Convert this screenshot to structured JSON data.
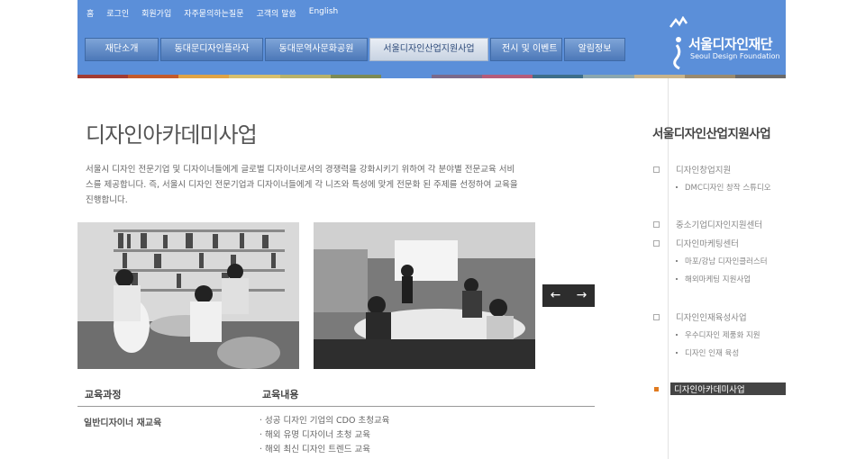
{
  "utility_nav": [
    "홈",
    "로그인",
    "회원가입",
    "자주묻의하는질문",
    "고객의 말씀",
    "English"
  ],
  "gnb": {
    "tabs": [
      "재단소개",
      "동대문디자인플라자",
      "동대문역사문화공원",
      "서울디자인산업지원사업",
      "전시 및 이벤트",
      "알림정보"
    ]
  },
  "logo": {
    "name": "서울디자인재단",
    "english": "Seoul Design Foundation"
  },
  "colorbar": [
    "#a23b32",
    "#c45a2a",
    "#e0a445",
    "#d7bf6c",
    "#b8b26a",
    "#7c8a55",
    "#5b8fd9",
    "#7a6a8c",
    "#b45c7a",
    "#3d6e8a",
    "#8aa7b0",
    "#c9b48a",
    "#9a8a6e",
    "#6a6a6a"
  ],
  "main": {
    "title": "디자인아카데미사업",
    "intro": "서울시 디자인 전문기업 및 디자이너들에게 글로벌 디자이너로서의 경쟁력을 강화시키기 위하여 각 분야별 전문교육 서비스를 제공합니다. 즉, 서울시 디자인 전문기업과 디자이너들에게 각 니즈와 특성에 맞게 전문화 된 주제를 선정하여 교육을 진행합니다.",
    "slider": {
      "prev": "←",
      "next": "→"
    },
    "table": {
      "headers": [
        "교육과정",
        "교육내용"
      ],
      "rows": [
        {
          "course": "일반디자이너 재교육",
          "contents": [
            "· 성공 디자인 기업의 CDO 초청교육",
            "· 해외 유명 디자이너 초청 교육",
            "· 해외 최신 디자인 트렌드 교육"
          ]
        }
      ]
    }
  },
  "sidebar": {
    "title": "서울디자인산업지원사업",
    "items": [
      {
        "label": "디자인창업지원",
        "subs": [
          "DMC디자인 창작 스튜디오"
        ]
      },
      {
        "label": "중소기업디자인지원센터",
        "subs": []
      },
      {
        "label": "디자인마케팅센터",
        "subs": [
          "마포/강남 디자인클러스터",
          "해외마케팅 지원사업"
        ]
      },
      {
        "label": "디자인인재육성사업",
        "subs": [
          "우수디자인 제품화 지원",
          "디자인 인재 육성"
        ]
      },
      {
        "label": "디자인아카데미사업",
        "subs": []
      }
    ],
    "active_index": 4
  },
  "colors": {
    "header_bg": "#5b8fd9",
    "active_marker": "#e07a1f",
    "active_bg": "#444444"
  }
}
